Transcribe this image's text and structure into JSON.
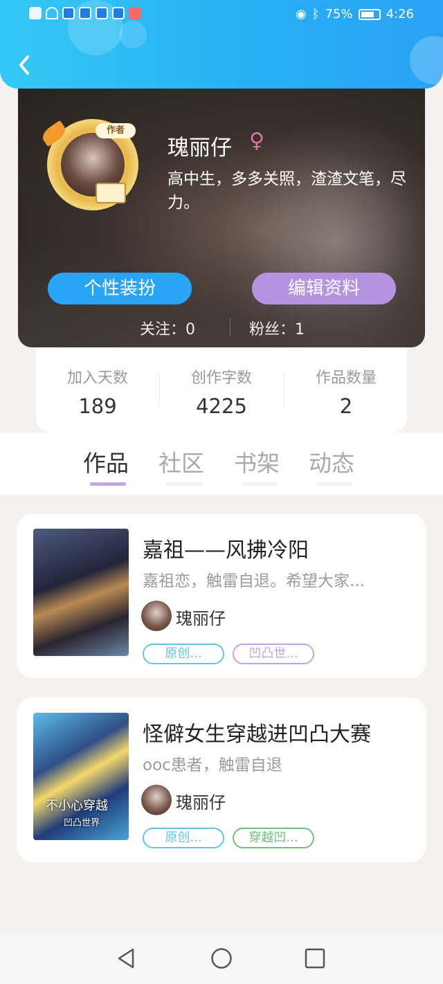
{
  "status_bar": {
    "battery": "75%",
    "time": "4:26"
  },
  "profile": {
    "avatar_badge": "作者",
    "name": "瑰丽仔",
    "gender_symbol": "♀",
    "bio": "高中生，多多关照，渣渣文笔，尽力。",
    "dress_button": "个性装扮",
    "edit_button": "编辑资料",
    "following": "关注：0",
    "followers": "粉丝：1"
  },
  "stats": [
    {
      "label": "加入天数",
      "value": "189"
    },
    {
      "label": "创作字数",
      "value": "4225"
    },
    {
      "label": "作品数量",
      "value": "2"
    }
  ],
  "tabs": [
    "作品",
    "社区",
    "书架",
    "动态"
  ],
  "works": [
    {
      "title": "嘉祖——风拂冷阳",
      "description": "嘉祖恋，触雷自退。希望大家...",
      "author": "瑰丽仔",
      "tags": [
        "原创...",
        "凹凸世..."
      ]
    },
    {
      "title": "怪僻女生穿越进凹凸大赛",
      "description": "ooc患者，触雷自退",
      "author": "瑰丽仔",
      "tags": [
        "原创...",
        "穿越凹..."
      ],
      "cover_text": "不小心穿越",
      "cover_subtext": "凹凸世界"
    }
  ]
}
